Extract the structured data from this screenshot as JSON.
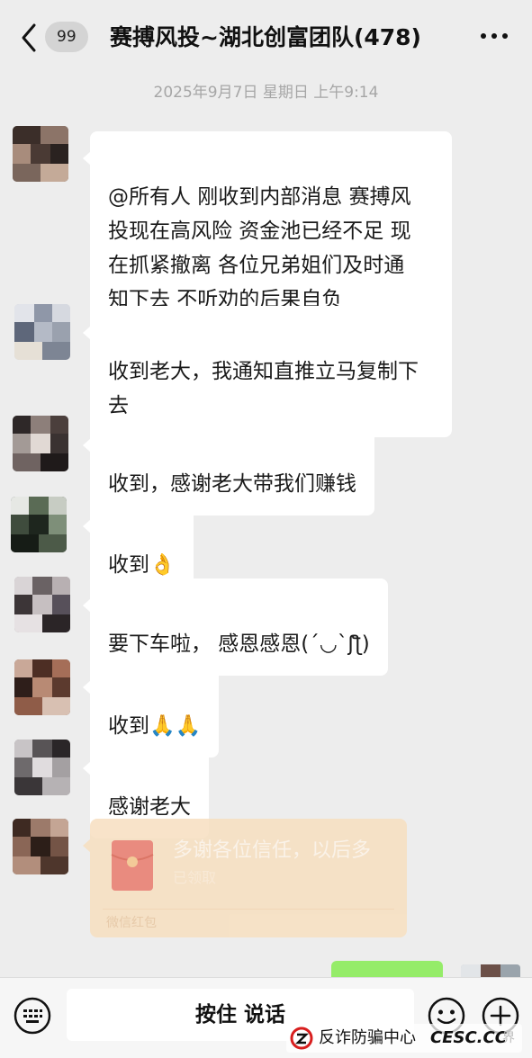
{
  "header": {
    "unread_badge": "99",
    "title": "赛搏风投~湖北创富团队(478)"
  },
  "timestamp": "2025年9月7日 星期日 上午9:14",
  "messages": [
    {
      "text": "@所有人 刚收到内部消息 赛搏风\n投现在高风险 资金池已经不足 现\n在抓紧撤离 各位兄弟姐们及时通\n知下去 不听劝的后果自负"
    },
    {
      "text": "收到老大，我通知直推立马复制下\n去"
    },
    {
      "text": "收到，感谢老大带我们赚钱"
    },
    {
      "text": "收到👌"
    },
    {
      "text": "要下车啦， 感恩感恩(´◡`ʃƪ)"
    },
    {
      "text": "收到🙏🙏"
    },
    {
      "text": "感谢老大"
    }
  ],
  "red_packet": {
    "title": "多谢各位信任，以后多",
    "status": "已领取",
    "footer": "微信红包"
  },
  "input_bar": {
    "hold_to_talk": "按住 说话"
  },
  "watermark": {
    "org": "反诈防骗中心",
    "site": "CESC.CC",
    "faint": "界"
  },
  "icons": {
    "back": "chevron-left-icon",
    "more": "more-dots-icon",
    "keyboard": "keyboard-icon",
    "emoji": "emoji-icon",
    "plus": "plus-icon",
    "red_packet": "red-packet-icon"
  },
  "colors": {
    "background": "#ededed",
    "bubble": "#ffffff",
    "self_bubble": "#95ec69",
    "red_packet": "#f7dfc0"
  }
}
